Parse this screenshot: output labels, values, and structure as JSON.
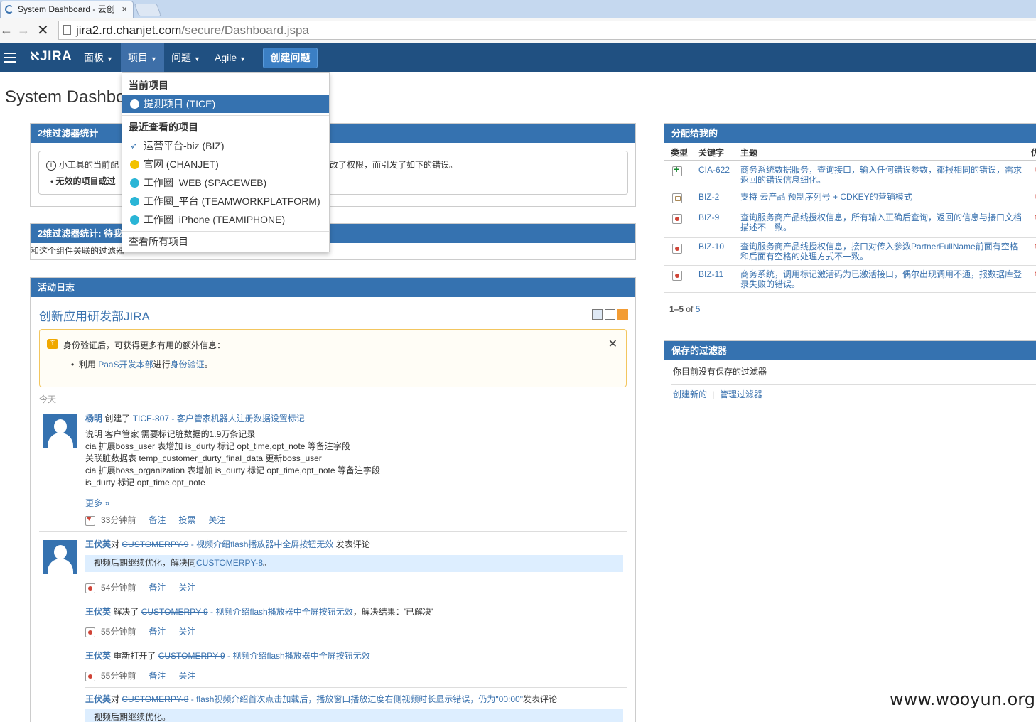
{
  "browser": {
    "tab_title": "System Dashboard - 云创",
    "tab_close": "×",
    "url_host": "jira2.rd.chanjet.com",
    "url_path": "/secure/Dashboard.jspa"
  },
  "header": {
    "logo": "JIRA",
    "menus": [
      "面板",
      "项目",
      "问题",
      "Agile"
    ],
    "create_button": "创建问题"
  },
  "page_title": "System Dashboard",
  "projects_dropdown": {
    "current_heading": "当前项目",
    "current_item": "提测项目 (TICE)",
    "recent_heading": "最近查看的项目",
    "recent_items": [
      "运营平台-biz (BIZ)",
      "官网 (CHANJET)",
      "工作圈_WEB (SPACEWEB)",
      "工作圈_平台 (TEAMWORKPLATFORM)",
      "工作圈_iPhone (TEAMIPHONE)"
    ],
    "view_all": "查看所有项目"
  },
  "gadget1": {
    "title": "2维过滤器统计",
    "info_text": "小工具的当前配",
    "info_text_tail": "改了权限，而引发了如下的错误。",
    "bullet": "无效的项目或过"
  },
  "gadget2": {
    "title": "2维过滤器统计: 待我",
    "body": "和这个组件关联的过滤器"
  },
  "activity": {
    "header": "活动日志",
    "title": "创新应用研发部JIRA",
    "warn_text": "身份验证后，可获得更多有用的额外信息：",
    "warn_bullet_prefix": "利用",
    "warn_bullet_link1": "PaaS开发本部",
    "warn_bullet_mid": "进行",
    "warn_bullet_link2": "身份验证",
    "warn_bullet_suffix": "。",
    "close": "✕",
    "today": "今天",
    "entry1": {
      "user": "杨明",
      "action": "创建了",
      "issue": "TICE-807 - 客户管家机器人注册数据设置标记",
      "lines": [
        "说明 客户管家 需要标记脏数据的1.9万条记录",
        "cia 扩展boss_user 表增加 is_durty 标记 opt_time,opt_note 等备注字段",
        "关联脏数据表 temp_customer_durty_final_data 更新boss_user",
        "cia 扩展boss_organization 表增加 is_durty 标记 opt_time,opt_note 等备注字段",
        "is_durty 标记 opt_time,opt_note"
      ],
      "more": "更多 »",
      "time": "33分钟前",
      "actions": [
        "备注",
        "投票",
        "关注"
      ]
    },
    "entry2": {
      "user": "王伏英",
      "action": "对",
      "issue_key": "CUSTOMERPY-9",
      "issue_title": " - 视频介绍flash播放器中全屏按钮无效",
      "tail": " 发表评论",
      "quote_prefix": "视频后期继续优化，解决同",
      "quote_link": "CUSTOMERPY-8",
      "quote_suffix": "。",
      "time": "54分钟前",
      "actions": [
        "备注",
        "关注"
      ]
    },
    "entry3": {
      "user": "王伏英",
      "action": " 解决了 ",
      "issue_key": "CUSTOMERPY-9",
      "issue_title": " - 视频介绍flash播放器中全屏按钮无效",
      "tail": "，解决结果：'已解决'",
      "time": "55分钟前",
      "actions": [
        "备注",
        "关注"
      ]
    },
    "entry4": {
      "user": "王伏英",
      "action": " 重新打开了 ",
      "issue_key": "CUSTOMERPY-9",
      "issue_title": " - 视频介绍flash播放器中全屏按钮无效",
      "time": "55分钟前",
      "actions": [
        "备注",
        "关注"
      ]
    },
    "entry5": {
      "user": "王伏英",
      "action": "对",
      "issue_key": "CUSTOMERPY-8",
      "issue_title": " - flash视频介绍首次点击加载后，播放窗口播放进度右侧视频时长显示错误，仍为\"00:00\"",
      "tail": "发表评论",
      "quote": "视频后期继续优化。"
    }
  },
  "assigned": {
    "title": "分配给我的",
    "columns": [
      "类型",
      "关键字",
      "主题",
      "优"
    ],
    "rows": [
      {
        "type": "plus",
        "key": "CIA-622",
        "summary": "商务系统数据服务，查询接口，输入任何错误参数，都报相同的错误，需求返回的错误信息细化。"
      },
      {
        "type": "feat",
        "key": "BIZ-2",
        "summary": "支持 云产品 预制序列号 + CDKEY的营销模式"
      },
      {
        "type": "bug",
        "key": "BIZ-9",
        "summary": "查询服务商产品线授权信息，所有输入正确后查询，返回的信息与接口文档描述不一致。"
      },
      {
        "type": "bug",
        "key": "BIZ-10",
        "summary": "查询服务商产品线授权信息，接口对传入参数PartnerFullName前面有空格和后面有空格的处理方式不一致。"
      },
      {
        "type": "bug",
        "key": "BIZ-11",
        "summary": "商务系统，调用标记激活码为已激活接口，偶尔出现调用不通，报数据库登录失败的错误。"
      }
    ],
    "pager_prefix": "1–5",
    "pager_of": " of ",
    "pager_total": "5"
  },
  "saved_filters": {
    "title": "保存的过滤器",
    "empty": "你目前没有保存的过滤器",
    "create": "创建新的",
    "manage": "管理过滤器"
  },
  "watermark": "www.wooyun.org"
}
